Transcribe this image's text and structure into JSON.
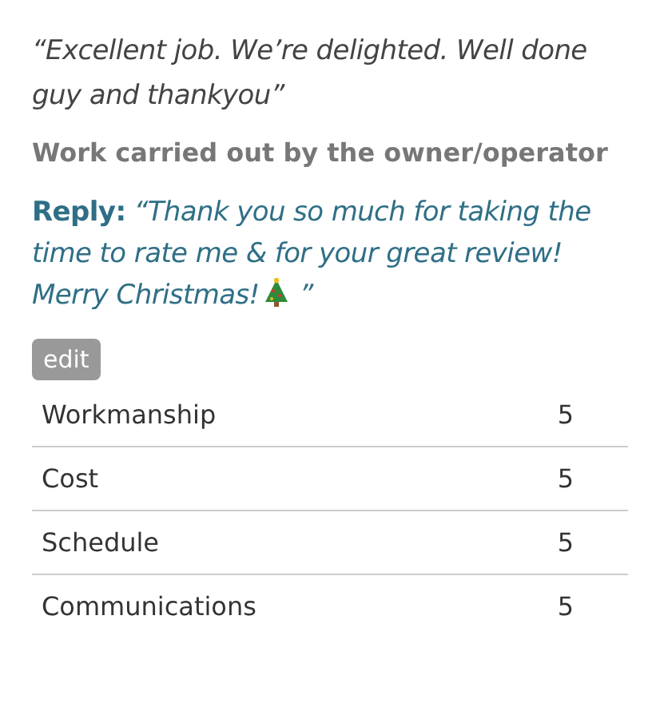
{
  "review": {
    "quote": "“Excellent job. We’re delighted. Well done guy and thankyou”",
    "work_note": "Work carried out by the owner/operator"
  },
  "reply": {
    "label": "Reply:",
    "text": "“Thank you so much for taking the time to rate me & for your great review! Merry Christmas!",
    "closing": " ”"
  },
  "edit_button": "edit",
  "ratings": [
    {
      "name": "Workmanship",
      "score": "5"
    },
    {
      "name": "Cost",
      "score": "5"
    },
    {
      "name": "Schedule",
      "score": "5"
    },
    {
      "name": "Communications",
      "score": "5"
    }
  ]
}
